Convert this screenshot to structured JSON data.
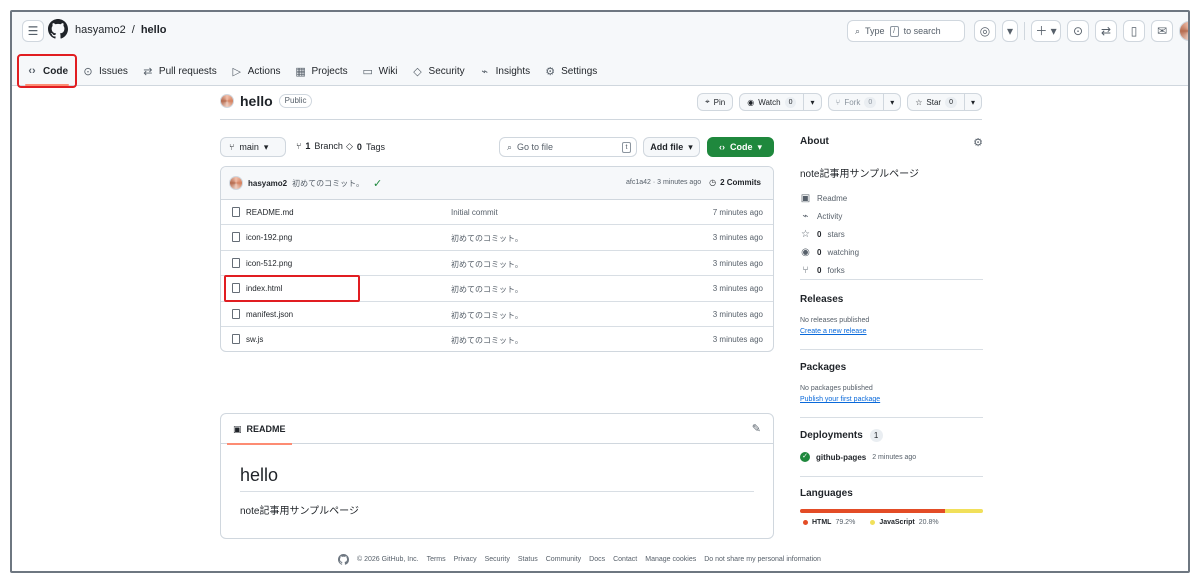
{
  "topbar": {
    "owner": "hasyamo2",
    "separator": "/",
    "repo": "hello",
    "search_prefix": "Type",
    "search_key": "/",
    "search_suffix": "to search"
  },
  "tabs": [
    {
      "label": "Code",
      "icon": "code-icon"
    },
    {
      "label": "Issues",
      "icon": "issue-icon"
    },
    {
      "label": "Pull requests",
      "icon": "pull-request-icon"
    },
    {
      "label": "Actions",
      "icon": "actions-icon"
    },
    {
      "label": "Projects",
      "icon": "projects-icon"
    },
    {
      "label": "Wiki",
      "icon": "wiki-icon"
    },
    {
      "label": "Security",
      "icon": "security-icon"
    },
    {
      "label": "Insights",
      "icon": "insights-icon"
    },
    {
      "label": "Settings",
      "icon": "settings-icon"
    }
  ],
  "repo": {
    "name": "hello",
    "visibility": "Public"
  },
  "actions": {
    "pin": "Pin",
    "watch": "Watch",
    "watch_count": "0",
    "fork": "Fork",
    "fork_count": "0",
    "star": "Star",
    "star_count": "0"
  },
  "branch_bar": {
    "branch": "main",
    "branch_count": "1",
    "branch_label": "Branch",
    "tag_count": "0",
    "tag_label": "Tags",
    "go_to_file": "Go to file",
    "shortcut": "t",
    "add_file": "Add file",
    "code": "Code"
  },
  "commit": {
    "user": "hasyamo2",
    "message": "初めてのコミット。",
    "hash_time": "afc1a42 · 3 minutes ago",
    "commit_count": "2 Commits"
  },
  "files": [
    {
      "name": "README.md",
      "message": "Initial commit",
      "time": "7 minutes ago"
    },
    {
      "name": "icon-192.png",
      "message": "初めてのコミット。",
      "time": "3 minutes ago"
    },
    {
      "name": "icon-512.png",
      "message": "初めてのコミット。",
      "time": "3 minutes ago"
    },
    {
      "name": "index.html",
      "message": "初めてのコミット。",
      "time": "3 minutes ago"
    },
    {
      "name": "manifest.json",
      "message": "初めてのコミット。",
      "time": "3 minutes ago"
    },
    {
      "name": "sw.js",
      "message": "初めてのコミット。",
      "time": "3 minutes ago"
    }
  ],
  "readme": {
    "tab": "README",
    "title": "hello",
    "text": "note記事用サンプルページ"
  },
  "sidebar": {
    "about_title": "About",
    "description": "note記事用サンプルページ",
    "items": [
      {
        "icon": "book-icon",
        "text": "Readme"
      },
      {
        "icon": "activity-icon",
        "text": "Activity"
      },
      {
        "icon": "star-icon",
        "count": "0",
        "text": "stars"
      },
      {
        "icon": "eye-icon",
        "count": "0",
        "text": "watching"
      },
      {
        "icon": "fork-icon",
        "count": "0",
        "text": "forks"
      }
    ],
    "releases_title": "Releases",
    "releases_text": "No releases published",
    "releases_link": "Create a new release",
    "packages_title": "Packages",
    "packages_text": "No packages published",
    "packages_link": "Publish your first package",
    "deployments_title": "Deployments",
    "deployments_count": "1",
    "deployment_name": "github-pages",
    "deployment_time": "2 minutes ago",
    "languages_title": "Languages",
    "languages": [
      {
        "name": "HTML",
        "percent": "79.2%",
        "value": 79.2,
        "color": "#e34c26"
      },
      {
        "name": "JavaScript",
        "percent": "20.8%",
        "value": 20.8,
        "color": "#f1e05a"
      }
    ]
  },
  "footer": {
    "copyright": "© 2026 GitHub, Inc.",
    "links": [
      "Terms",
      "Privacy",
      "Security",
      "Status",
      "Community",
      "Docs",
      "Contact",
      "Manage cookies",
      "Do not share my personal information"
    ]
  },
  "colors": {
    "accent": "#fd8c73",
    "green": "#1f883d",
    "highlight": "#e11d21",
    "link": "#0969da"
  }
}
